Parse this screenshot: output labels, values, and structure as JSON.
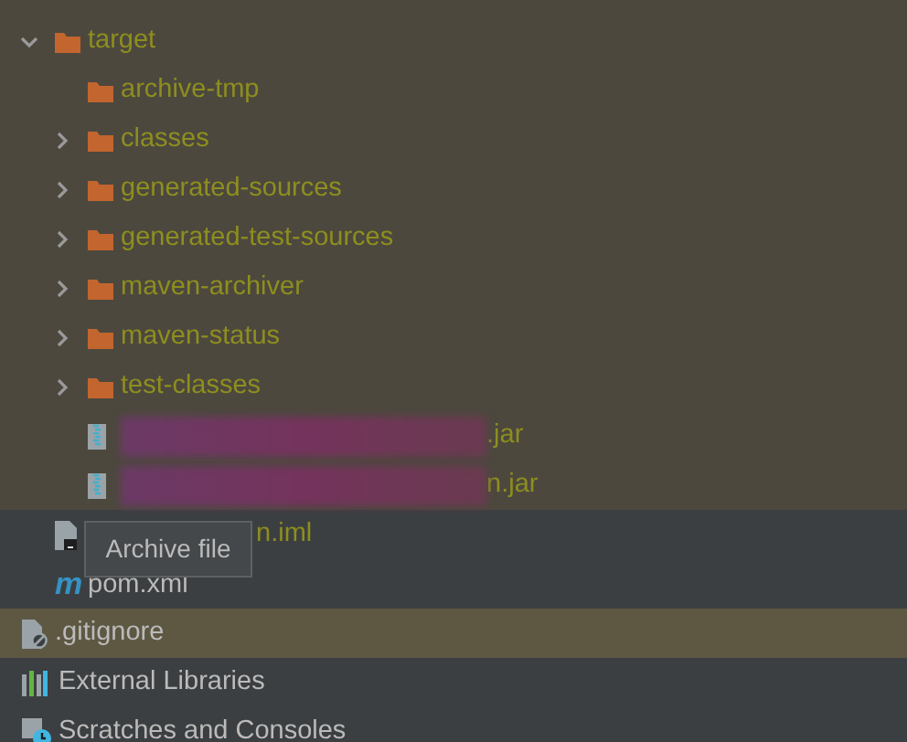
{
  "module_contents": [
    {
      "kind": "folder",
      "label": "target",
      "expanded": true,
      "excluded": true,
      "selected": false,
      "children": [
        {
          "kind": "empty-folder",
          "label": "archive-tmp",
          "excluded": true,
          "selected": false
        },
        {
          "kind": "folder",
          "label": "classes",
          "expanded": false,
          "excluded": true,
          "selected": false
        },
        {
          "kind": "folder",
          "label": "generated-sources",
          "expanded": false,
          "excluded": true,
          "selected": false
        },
        {
          "kind": "folder",
          "label": "generated-test-sources",
          "expanded": false,
          "excluded": true,
          "selected": false
        },
        {
          "kind": "folder",
          "label": "maven-archiver",
          "expanded": false,
          "excluded": true,
          "selected": false
        },
        {
          "kind": "folder",
          "label": "maven-status",
          "expanded": false,
          "excluded": true,
          "selected": false
        },
        {
          "kind": "folder",
          "label": "test-classes",
          "expanded": false,
          "excluded": true,
          "selected": false
        },
        {
          "kind": "archive",
          "label": ".jar",
          "redacted": true,
          "excluded": true,
          "selected": false
        },
        {
          "kind": "archive",
          "label": "n.jar",
          "redacted": true,
          "excluded": true,
          "selected": false
        }
      ]
    },
    {
      "kind": "module-file",
      "label": "n.iml",
      "excluded": true,
      "selected": false
    },
    {
      "kind": "maven",
      "icon_text": "m",
      "label": "pom.xml",
      "excluded": false,
      "selected": false
    }
  ],
  "root_items": [
    {
      "kind": "ignore-file",
      "label": ".gitignore",
      "excluded": false,
      "selected": true
    },
    {
      "kind": "libraries",
      "label": "External Libraries",
      "excluded": false,
      "selected": false
    },
    {
      "kind": "scratches",
      "label": "Scratches and Consoles",
      "excluded": false,
      "selected": false
    }
  ],
  "tooltip": {
    "text": "Archive file"
  }
}
